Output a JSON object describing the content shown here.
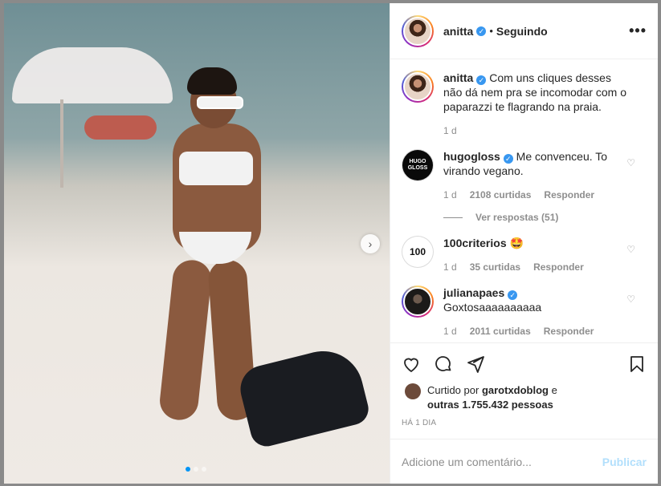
{
  "header": {
    "username": "anitta",
    "separator": "•",
    "follow_status": "Seguindo",
    "more_icon": "•••"
  },
  "caption": {
    "username": "anitta",
    "text": "Com uns cliques desses não dá nem pra se incomodar com o paparazzi te flagrando na praia.",
    "time": "1 d"
  },
  "comments": [
    {
      "username": "hugogloss",
      "avatar_text": "HUGO GLOSS",
      "text": "Me convenceu. To virando vegano.",
      "time": "1 d",
      "likes": "2108 curtidas",
      "reply": "Responder",
      "view_replies": "Ver respostas (51)"
    },
    {
      "username": "100criterios",
      "avatar_text": "100",
      "text": "🤩",
      "time": "1 d",
      "likes": "35 curtidas",
      "reply": "Responder"
    },
    {
      "username": "julianapaes",
      "text": "Goxtosaaaaaaaaaa",
      "time": "1 d",
      "likes": "2011 curtidas",
      "reply": "Responder"
    }
  ],
  "likes": {
    "prefix": "Curtido por",
    "user": "garotxdoblog",
    "middle": "e",
    "others": "outras 1.755.432 pessoas"
  },
  "timestamp": "HÁ 1 DIA",
  "add_comment": {
    "placeholder": "Adicione um comentário...",
    "post_label": "Publicar"
  },
  "media": {
    "next_icon": "›",
    "page_count": 3,
    "active_page": 1
  },
  "colors": {
    "verified": "#3897f0",
    "post_button": "#b2dffc",
    "active_dot": "#0095f6"
  }
}
